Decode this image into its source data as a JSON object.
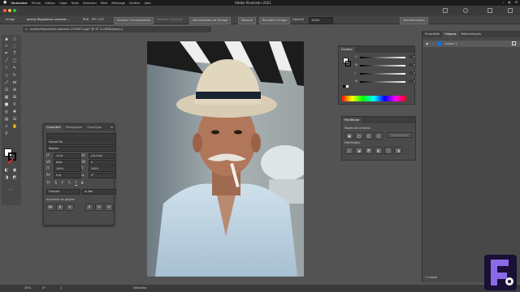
{
  "menubar": {
    "apple": "",
    "items": [
      "Illustrator",
      "Fichier",
      "Edition",
      "Objet",
      "Texte",
      "Sélection",
      "Effet",
      "Affichage",
      "Fenêtre",
      "Aide"
    ],
    "title": "Adobe Illustrator 2021",
    "status": [
      "⌕",
      "◐",
      "☰"
    ]
  },
  "controlbar": {
    "image_label": "Image",
    "filename": "pexels-fitguestoro-santana-...",
    "ppi_label": "PPI: 219",
    "rgb": "RVB",
    "embed_button": "Annuler l'incorporation",
    "modify_original": "Modifier l'original",
    "vectorize": "Vectorisation de l'image",
    "mask_button": "Masque",
    "crop_button": "Recadrer l'image",
    "opacity_label": "Opacité",
    "opacity_value": "100%",
    "transform_button": "Transformation"
  },
  "document": {
    "tab_label": "pexels-fitguestoro-santana-1935873.jpg* @ 35 % (RVB/Aperçu)"
  },
  "character_panel": {
    "tabs": [
      "Caractère",
      "Paragraphe",
      "OpenType"
    ],
    "search_placeholder": "",
    "font_family": "Myriad Pro",
    "font_style": "Regular",
    "font_size": "12 pt",
    "leading": "(14,4 pt)",
    "kerning": "Auto",
    "tracking": "0",
    "scale_v": "100%",
    "scale_h": "100%",
    "baseline": "0 pt",
    "rotation": "0°",
    "style_buttons": [
      "TT",
      "Tr",
      "T'",
      "T,",
      "T",
      "T"
    ],
    "language": "Français",
    "aa": "aₐ Net",
    "snap_label": "Accrocher au glyphe",
    "snap_buttons": [
      "Aa",
      "A̲",
      "A",
      "A",
      "A",
      "A"
    ]
  },
  "color_panel": {
    "title": "Couleur",
    "channels": [
      {
        "label": "C",
        "value": "0"
      },
      {
        "label": "M",
        "value": "0"
      },
      {
        "label": "J",
        "value": "0"
      },
      {
        "label": "N",
        "value": "0"
      }
    ],
    "percent": "%"
  },
  "pathfinder_panel": {
    "title": "Pathfinder",
    "shape_modes_label": "Modes de la forme :",
    "expand_button": "Décomposer",
    "pathfinders_label": "Pathfinders :"
  },
  "right_dock": {
    "tabs": [
      "Propriétés",
      "Calques",
      "Bibliothèques"
    ],
    "layer_name": "Calque 1",
    "layers_count": "1 Calque"
  },
  "statusbar": {
    "zoom": "35%",
    "angle": "0°",
    "artboard": "1",
    "tool": "Sélection"
  },
  "colors": {
    "panel_bg": "#4a4a4a",
    "accent": "#1473e6",
    "logo_bg": "#1a0f35",
    "logo_accent": "#8b6ae8"
  }
}
